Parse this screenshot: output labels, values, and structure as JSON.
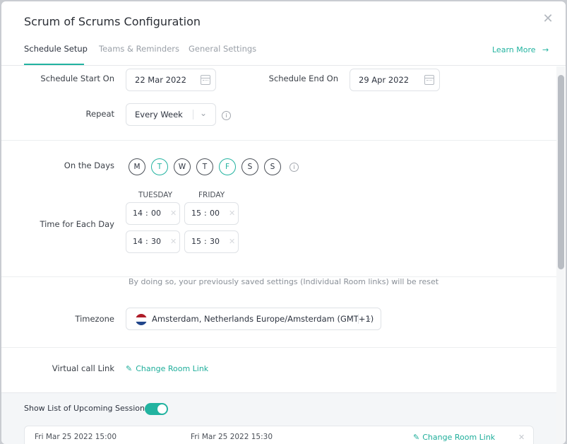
{
  "modal": {
    "title": "Scrum of Scrums Configuration",
    "close_icon": "close-icon"
  },
  "tabs": [
    {
      "label": "Schedule Setup",
      "active": true
    },
    {
      "label": "Teams & Reminders",
      "active": false
    },
    {
      "label": "General Settings",
      "active": false
    }
  ],
  "learn_more": {
    "label": "Learn More",
    "icon": "arrow-right-icon"
  },
  "schedule": {
    "start_label": "Schedule Start On",
    "start_value": "22 Mar 2022",
    "end_label": "Schedule End On",
    "end_value": "29 Apr 2022",
    "repeat_label": "Repeat",
    "repeat_value": "Every Week"
  },
  "days": {
    "label": "On the Days",
    "items": [
      {
        "letter": "M",
        "selected": false
      },
      {
        "letter": "T",
        "selected": true
      },
      {
        "letter": "W",
        "selected": false
      },
      {
        "letter": "T",
        "selected": false
      },
      {
        "letter": "F",
        "selected": true
      },
      {
        "letter": "S",
        "selected": false
      },
      {
        "letter": "S",
        "selected": false
      }
    ]
  },
  "times": {
    "label": "Time for Each Day",
    "columns": [
      {
        "day": "TUESDAY",
        "start_h": "14",
        "start_m": "00",
        "end_h": "14",
        "end_m": "30"
      },
      {
        "day": "FRIDAY",
        "start_h": "15",
        "start_m": "00",
        "end_h": "15",
        "end_m": "30"
      }
    ]
  },
  "reset_note": "By doing so, your previously saved settings (Individual Room links) will be reset",
  "timezone": {
    "label": "Timezone",
    "value": "Amsterdam, Netherlands Europe/Amsterdam (GMT+1)",
    "flag_colors": [
      "#ae1c28",
      "#ffffff",
      "#21468b"
    ]
  },
  "virtual_call": {
    "label": "Virtual call Link",
    "link_text": "Change Room Link"
  },
  "upcoming": {
    "label": "Show List of Upcoming Sessions",
    "toggle_on": true,
    "sessions": [
      {
        "start": "Fri Mar 25 2022 15:00",
        "end": "Fri Mar 25 2022 15:30",
        "link_text": "Change Room Link"
      }
    ]
  },
  "colors": {
    "accent": "#22b3a0",
    "text": "#2e3440",
    "muted": "#9aa0a8"
  }
}
